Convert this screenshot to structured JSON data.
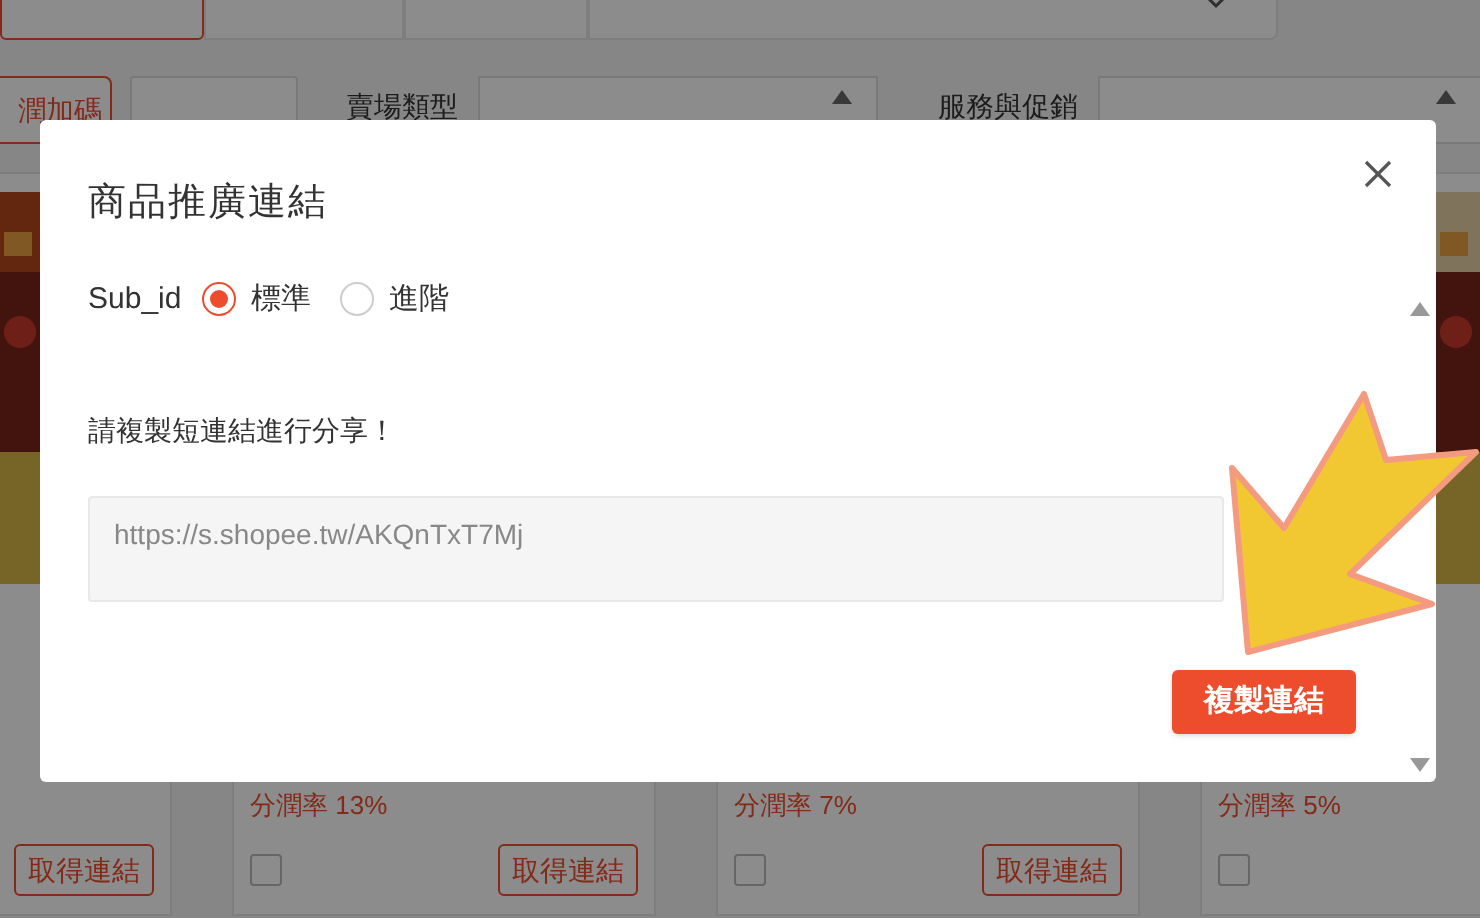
{
  "filter_tabs": [
    {
      "selected": true
    },
    {
      "selected": false
    },
    {
      "selected": false
    }
  ],
  "filters": {
    "promo_tag": "潤加碼",
    "shop_type_label": "賣場類型",
    "service_label": "服務與促銷"
  },
  "product_cards": [
    {
      "button": "取得連結"
    },
    {
      "commission": "分潤率 13%",
      "button": "取得連結",
      "checked": false
    },
    {
      "commission": "分潤率 7%",
      "button": "取得連結",
      "checked": false
    },
    {
      "commission": "分潤率 5%",
      "checked": false
    }
  ],
  "modal": {
    "title": "商品推廣連結",
    "sub_id_label": "Sub_id",
    "options": [
      {
        "label": "標準",
        "selected": true
      },
      {
        "label": "進階",
        "selected": false
      }
    ],
    "instruction": "請複製短連結進行分享！",
    "link": "https://s.shopee.tw/AKQnTxT7Mj",
    "copy_button": "複製連結"
  }
}
